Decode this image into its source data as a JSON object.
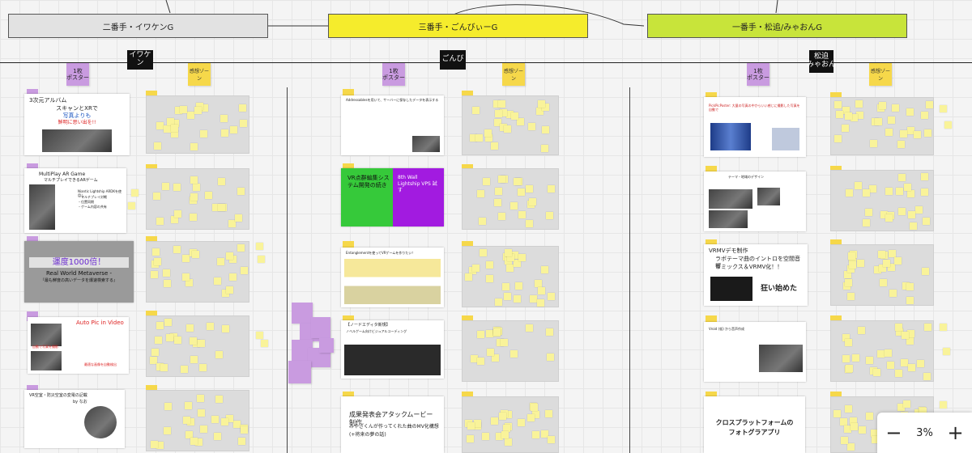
{
  "groups": [
    {
      "header": "二番手・イワケンG",
      "tag": "イワケン",
      "poster_label": "1枚\nポスター",
      "zone_label": "感想ゾーン"
    },
    {
      "header": "三番手・ごんびぃーG",
      "tag": "ごんび",
      "poster_label": "1枚\nポスター",
      "zone_label": "感想ゾーン"
    },
    {
      "header": "一番手・松追/みゃおんG",
      "tag": "松迫\nみゃおん",
      "poster_label": "1枚\nポスター",
      "zone_label": "感想ゾーン"
    }
  ],
  "posters": {
    "g1": [
      {
        "title": "3次元アルバム",
        "lines": [
          "スキャンとXRで",
          "写真よりも",
          "鮮明に思い出を!!"
        ]
      },
      {
        "title": "MultiPlay AR Game",
        "lines": [
          "マルチプレイできるARゲーム",
          "Niantic Lightship ARDKを使用し",
          "・マルチプレイ対戦",
          "・位置同期",
          "・ゲーム内容の共有"
        ]
      },
      {
        "title": "運度1000倍！",
        "lines": [
          "Real World Metaverse -",
          "『最も鮮度の高いデータを爆速検索する』"
        ]
      },
      {
        "title": "Auto Pic in Video",
        "lines": [
          "自動で写真を撮影",
          "最適な画像を自動検出"
        ]
      },
      {
        "title": "VR空室・防災空室の変電の記載",
        "lines": [
          "by なお"
        ]
      }
    ],
    "g2": [
      {
        "title": "Addressablesを用いて、サーバーに保存したデータを表示する",
        "lines": []
      },
      {
        "title": "VR点群編集システム開発の続き",
        "alt": "8th Wall Lightship VPS 試す",
        "lines": []
      },
      {
        "title": "Entanglementを使ってVRゲームを作りたい！",
        "lines": []
      },
      {
        "title": "【ノードエディタ新規】",
        "lines": [
          "ノベルゲーム向けビジュアルコーディング"
        ]
      },
      {
        "title": "成果発表会アタックムービー制作",
        "lines": [
          "みやざくんが作ってくれた曲のMV化構想",
          "(+将来の夢の話)"
        ]
      }
    ],
    "g3": [
      {
        "title": "PickPicPoster: 大量の写真の中からいい感じに撮影した写真を自動で",
        "lines": []
      },
      {
        "title": "テーマ・地域のデザイン",
        "lines": []
      },
      {
        "title": "VRMVデモ制作",
        "lines": [
          "ラボテーマ曲のイントロを空間音響",
          "リミックス＆VRMV化！！",
          "狂い始めた"
        ]
      },
      {
        "title": "Vroid (仮) から音声作成",
        "lines": []
      },
      {
        "title": "クロスプラットフォームの",
        "lines": [
          "フォトグラアプリ"
        ]
      }
    ]
  },
  "zone_tags": "感想",
  "sticky_samples": [
    "まるる",
    "まるる",
    "AR 2022",
    "最新！",
    "面白い"
  ],
  "zoom": {
    "minus": "−",
    "value": "3%",
    "plus": "+"
  },
  "colors": {
    "yellow_header": "#f5ec2c",
    "green_header": "#c8e43a",
    "gray_header": "#e2e2e2",
    "purple_note": "#c99be0",
    "sticky": "#f9f39a"
  }
}
